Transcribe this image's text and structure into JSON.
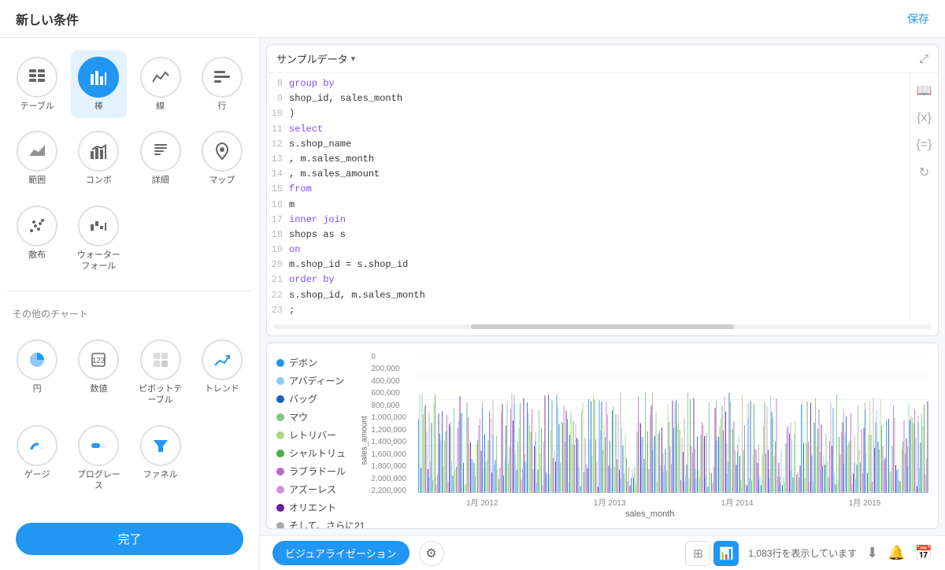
{
  "topbar": {
    "title": "新しい条件",
    "save_label": "保存"
  },
  "sidebar": {
    "chart_types": [
      {
        "id": "table",
        "label": "テーブル",
        "icon": "⊞",
        "active": false
      },
      {
        "id": "bar",
        "label": "棒",
        "icon": "📊",
        "active": true
      },
      {
        "id": "line",
        "label": "線",
        "icon": "〰",
        "active": false
      },
      {
        "id": "row",
        "label": "行",
        "icon": "☰",
        "active": false
      },
      {
        "id": "range",
        "label": "範囲",
        "icon": "📈",
        "active": false
      },
      {
        "id": "combo",
        "label": "コンボ",
        "icon": "📉",
        "active": false
      },
      {
        "id": "detail",
        "label": "詳細",
        "icon": "📄",
        "active": false
      },
      {
        "id": "map",
        "label": "マップ",
        "icon": "📍",
        "active": false
      },
      {
        "id": "scatter",
        "label": "散布",
        "icon": "⚬",
        "active": false
      },
      {
        "id": "waterfall",
        "label": "ウォーターフォール",
        "icon": "📊",
        "active": false
      }
    ],
    "other_charts_label": "その他のチャート",
    "other_charts": [
      {
        "id": "pie",
        "label": "円",
        "icon": "◑",
        "active": false
      },
      {
        "id": "number",
        "label": "数値",
        "icon": "⊡",
        "active": false
      },
      {
        "id": "pivot",
        "label": "ピボットテーブル",
        "icon": "⊞",
        "active": false
      },
      {
        "id": "trend",
        "label": "トレンド",
        "icon": "↗",
        "active": false
      },
      {
        "id": "gauge",
        "label": "ゲージ",
        "icon": "◎",
        "active": false
      },
      {
        "id": "progress",
        "label": "プログレース",
        "icon": "▭",
        "active": false
      },
      {
        "id": "funnel",
        "label": "ファネル",
        "icon": "⫠",
        "active": false
      }
    ],
    "done_button": "完了"
  },
  "sql_panel": {
    "title": "サンプルデータ",
    "lines": [
      {
        "num": "8",
        "content": "    group by",
        "parts": [
          {
            "type": "kw",
            "text": "group by"
          }
        ]
      },
      {
        "num": "9",
        "content": "        shop_id, sales_month",
        "indent": "        ",
        "parts": [
          {
            "type": "ident",
            "text": "shop_id, sales_month"
          }
        ]
      },
      {
        "num": "10",
        "content": ")",
        "parts": [
          {
            "type": "ident",
            "text": ")"
          }
        ]
      },
      {
        "num": "11",
        "content": "select",
        "parts": [
          {
            "type": "kw",
            "text": "select"
          }
        ]
      },
      {
        "num": "12",
        "content": "    s.shop_name",
        "indent": "    ",
        "parts": [
          {
            "type": "ident",
            "text": "s.shop_name"
          }
        ]
      },
      {
        "num": "13",
        "content": "    , m.sales_month",
        "indent": "    ",
        "parts": [
          {
            "type": "ident",
            "text": ", m.sales_month"
          }
        ]
      },
      {
        "num": "14",
        "content": "    , m.sales_amount",
        "indent": "    ",
        "parts": [
          {
            "type": "ident",
            "text": ", m.sales_amount"
          }
        ]
      },
      {
        "num": "15",
        "content": "from",
        "parts": [
          {
            "type": "kw",
            "text": "from"
          }
        ]
      },
      {
        "num": "16",
        "content": "    m",
        "indent": "    ",
        "parts": [
          {
            "type": "ident",
            "text": "m"
          }
        ]
      },
      {
        "num": "17",
        "content": "inner join",
        "parts": [
          {
            "type": "kw",
            "text": "inner join"
          }
        ]
      },
      {
        "num": "18",
        "content": "    shops as s",
        "indent": "    ",
        "parts": [
          {
            "type": "ident",
            "text": "shops as s"
          }
        ]
      },
      {
        "num": "19",
        "content": "on",
        "parts": [
          {
            "type": "kw",
            "text": "on"
          }
        ]
      },
      {
        "num": "20",
        "content": "    m.shop_id = s.shop_id",
        "indent": "    ",
        "parts": [
          {
            "type": "ident",
            "text": "m.shop_id = s.shop_id"
          }
        ]
      },
      {
        "num": "21",
        "content": "order by",
        "parts": [
          {
            "type": "kw",
            "text": "order by"
          }
        ]
      },
      {
        "num": "22",
        "content": "    s.shop_id, m.sales_month",
        "indent": "    ",
        "parts": [
          {
            "type": "ident",
            "text": "s.shop_id, m.sales_month"
          }
        ]
      },
      {
        "num": "23",
        "content": ";",
        "parts": [
          {
            "type": "ident",
            "text": ";"
          }
        ]
      }
    ]
  },
  "chart": {
    "legend": [
      {
        "label": "デボン",
        "color": "#2196f3"
      },
      {
        "label": "アバディーン",
        "color": "#90caf9"
      },
      {
        "label": "バッグ",
        "color": "#1565c0"
      },
      {
        "label": "マウ",
        "color": "#81c784"
      },
      {
        "label": "レトリバー",
        "color": "#aed581"
      },
      {
        "label": "シャルトリュ",
        "color": "#4caf50"
      },
      {
        "label": "ラブラドール",
        "color": "#ba68c8"
      },
      {
        "label": "アズーレス",
        "color": "#ce93d8"
      },
      {
        "label": "オリエント",
        "color": "#6a1b9a"
      },
      {
        "label": "そして、さらに21",
        "color": "#aaa"
      }
    ],
    "y_axis_labels": [
      "2,200,000",
      "2,000,000",
      "1,800,000",
      "1,600,000",
      "1,400,000",
      "1,200,000",
      "1,000,000",
      "800,000",
      "600,000",
      "400,000",
      "200,000",
      "0"
    ],
    "y_axis_title": "sales_amount",
    "x_axis_labels": [
      "1月 2012",
      "1月 2013",
      "1月 2014",
      "1月 2015"
    ],
    "x_axis_title": "sales_month"
  },
  "bottom_bar": {
    "visualize_button": "ビジュアライゼーション",
    "row_count": "1,083行を表示しています",
    "table_icon": "⊞",
    "chart_icon": "📊"
  }
}
